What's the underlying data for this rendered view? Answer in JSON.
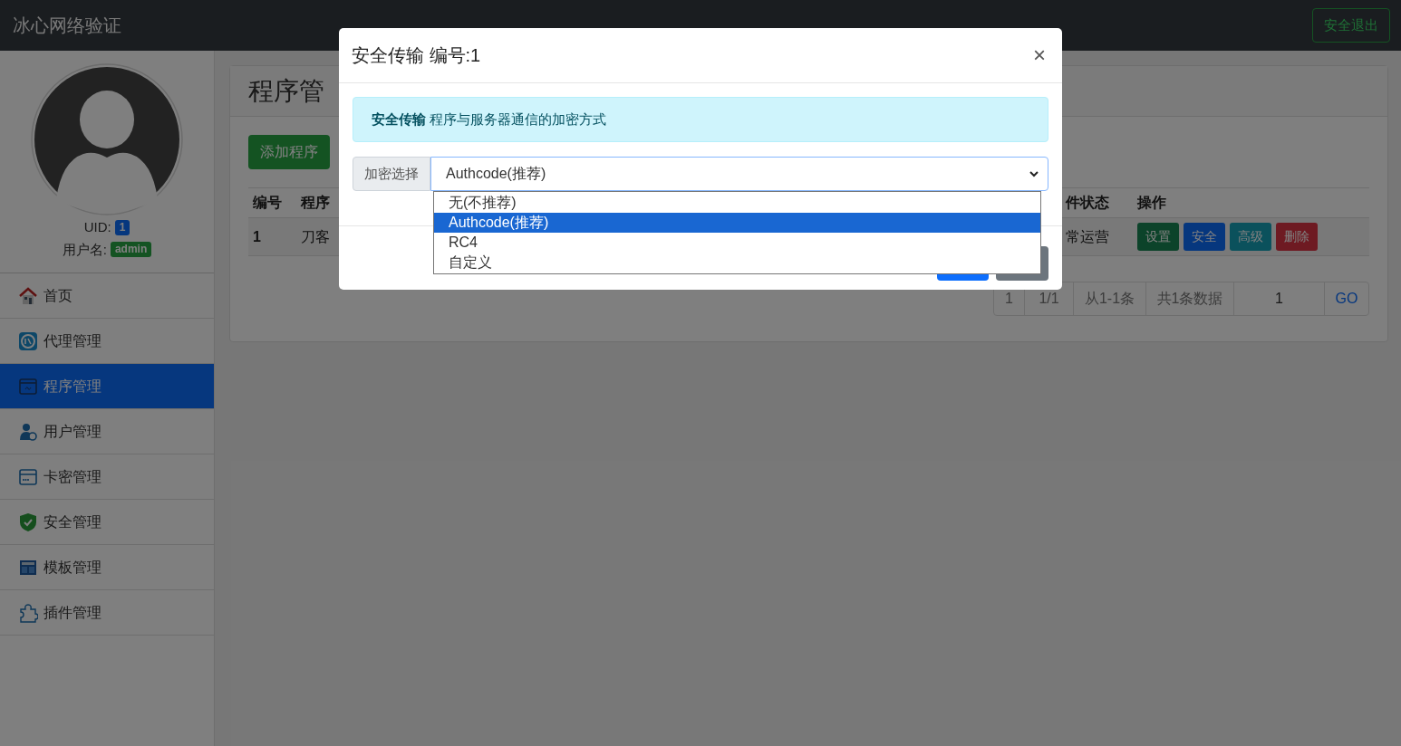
{
  "header": {
    "title": "冰心网络验证",
    "logout_button": "安全退出"
  },
  "sidebar": {
    "uid_label": "UID:",
    "uid": "1",
    "username_label": "用户名:",
    "username": "admin",
    "items": [
      {
        "label": "首页",
        "selected": false
      },
      {
        "label": "代理管理",
        "selected": false
      },
      {
        "label": "程序管理",
        "selected": true
      },
      {
        "label": "用户管理",
        "selected": false
      },
      {
        "label": "卡密管理",
        "selected": false
      },
      {
        "label": "安全管理",
        "selected": false
      },
      {
        "label": "模板管理",
        "selected": false
      },
      {
        "label": "插件管理",
        "selected": false
      }
    ]
  },
  "main": {
    "title": "程序管",
    "add_button": "添加程序",
    "table": {
      "columns": [
        "编号",
        "程序",
        "件状态",
        "操作"
      ],
      "rows": [
        {
          "cells": [
            "1",
            "刀客",
            "常运营"
          ],
          "actions": [
            {
              "label": "设置"
            },
            {
              "label": "安全"
            },
            {
              "label": "高级"
            },
            {
              "label": "删除"
            }
          ]
        }
      ]
    },
    "pagination": [
      "1",
      "1/1",
      "从1-1条",
      "共1条数据"
    ],
    "page_input": "1",
    "go_button": "GO"
  },
  "modal": {
    "title": "安全传输 编号:1",
    "close": "×",
    "alert": "**安全传输** 程序与服务器通信的加密方式",
    "select_label": "加密选择",
    "select_value": "Authcode(推荐)",
    "options": [
      {
        "label": "无(不推荐)",
        "selected": false
      },
      {
        "label": "Authcode(推荐)",
        "selected": true
      },
      {
        "label": "RC4",
        "selected": false
      },
      {
        "label": "自定义",
        "selected": false
      }
    ]
  }
}
